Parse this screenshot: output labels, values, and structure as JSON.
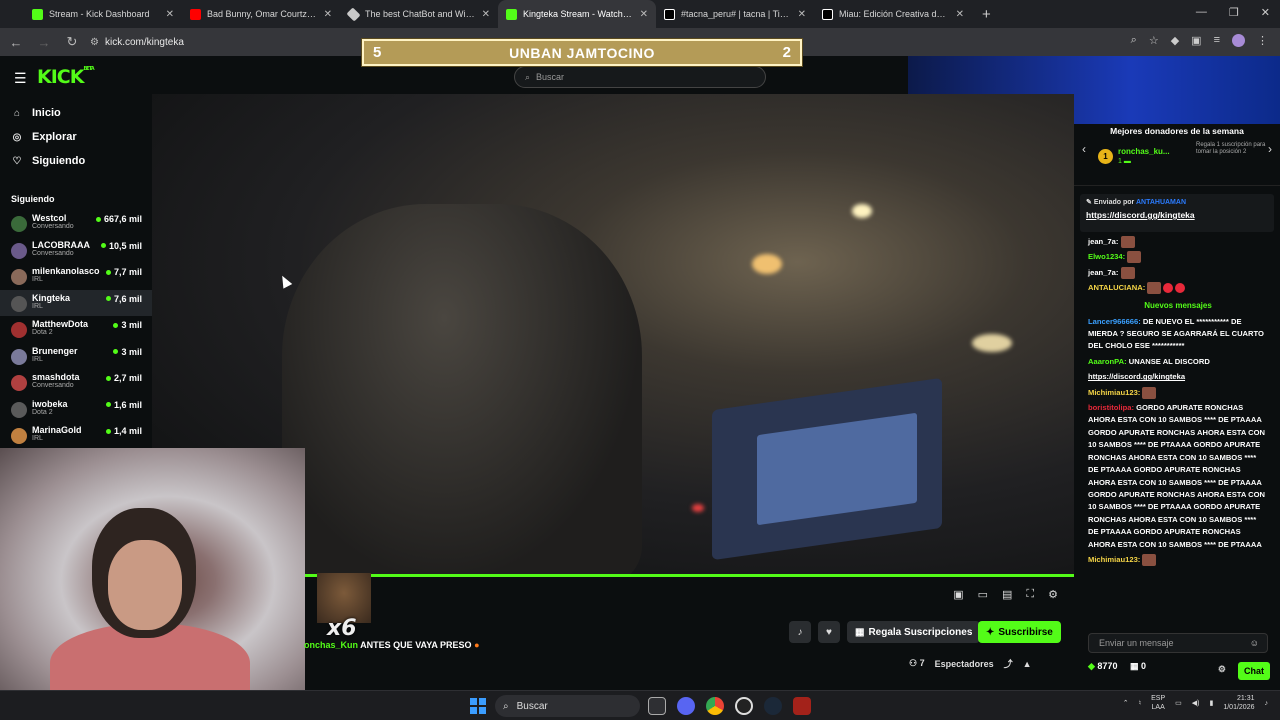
{
  "browser": {
    "tabs": [
      {
        "title": "Stream - Kick Dashboard",
        "color": "#53fc18",
        "active": false
      },
      {
        "title": "Bad Bunny, Omar Courtz, Dei V",
        "color": "#ff0000",
        "active": false
      },
      {
        "title": "The best ChatBot and Widgets",
        "color": "#c9c9c9",
        "active": false
      },
      {
        "title": "Kingteka Stream - Watch Live o",
        "color": "#53fc18",
        "active": true
      },
      {
        "title": "#tacna_peru# | tacna | TikTok",
        "color": "#ffffff",
        "active": false
      },
      {
        "title": "Miau: Edición Creativa de Josen",
        "color": "#ffffff",
        "active": false
      }
    ],
    "url": "kick.com/kingteka"
  },
  "banner": {
    "left": "5",
    "text": "UNBAN JAMTOCINO",
    "right": "2"
  },
  "header": {
    "search_placeholder": "Buscar"
  },
  "sidebar": {
    "nav": [
      {
        "label": "Inicio",
        "icon": "home-icon"
      },
      {
        "label": "Explorar",
        "icon": "compass-icon"
      },
      {
        "label": "Siguiendo",
        "icon": "heart-icon"
      }
    ],
    "following_title": "Siguiendo",
    "following": [
      {
        "name": "Westcol",
        "category": "Conversando",
        "viewers": "667,6 mil",
        "color": "#3a6a3a"
      },
      {
        "name": "LACOBRAAA",
        "category": "Conversando",
        "viewers": "10,5 mil",
        "color": "#6a5a8a"
      },
      {
        "name": "milenkanolasco",
        "category": "IRL",
        "viewers": "7,7 mil",
        "color": "#8a6a5a"
      },
      {
        "name": "Kingteka",
        "category": "IRL",
        "viewers": "7,6 mil",
        "color": "#555555"
      },
      {
        "name": "MatthewDota",
        "category": "Dota 2",
        "viewers": "3 mil",
        "color": "#a03030"
      },
      {
        "name": "Brunenger",
        "category": "IRL",
        "viewers": "3 mil",
        "color": "#7a7a9a"
      },
      {
        "name": "smashdota",
        "category": "Conversando",
        "viewers": "2,7 mil",
        "color": "#b04040"
      },
      {
        "name": "iwobeka",
        "category": "Dota 2",
        "viewers": "1,6 mil",
        "color": "#5a5a5a"
      },
      {
        "name": "MarinaGold",
        "category": "IRL",
        "viewers": "1,4 mil",
        "color": "#c08040"
      }
    ]
  },
  "alert": {
    "user": "onchas_Kun",
    "message": " ANTES QUE VAYA PRESO",
    "multiplier": "x6"
  },
  "channel": {
    "gift_label": "Regala Suscripciones",
    "subscribe_label": "Suscribirse",
    "viewers_label": "Espectadores",
    "viewers_count": "7"
  },
  "chat": {
    "donors_title": "Mejores donadores de la semana",
    "donor_rank": "1",
    "donor_name": "ronchas_ku...",
    "donor_amount": "1",
    "donor_hint": "Regala 1 suscripción para tomar la posición 2",
    "pinned_prefix": "Enviado por",
    "pinned_user": "ANTAHUAMAN",
    "pinned_link": "https://discord.gg/kingteka",
    "messages_top": [
      {
        "user": "jean_7a:",
        "color": "#ffffff",
        "text": ""
      },
      {
        "user": "Elwo1234:",
        "color": "#53fc18",
        "text": ""
      },
      {
        "user": "jean_7a:",
        "color": "#ffffff",
        "text": ""
      },
      {
        "user": "ANTALUCIANA:",
        "color": "#f5d547",
        "text": ""
      }
    ],
    "new_messages_label": "Nuevos mensajes",
    "messages": [
      {
        "user": "Lancer966666:",
        "color": "#3aa0ff",
        "text": " DE NUEVO EL *********** DE MIERDA ? SEGURO SE AGARRARÁ EL CUARTO DEL CHOLO ESE ***********"
      },
      {
        "user": "AaaronPA:",
        "color": "#53fc18",
        "text": " UNANSE AL DISCORD"
      },
      {
        "user": "",
        "color": "#ffffff",
        "text": "https://discord.gg/kingteka"
      },
      {
        "user": "Michimiau123:",
        "color": "#f5d547",
        "text": ""
      },
      {
        "user": "boristitolipa:",
        "color": "#e8293a",
        "text": " GORDO APURATE RONCHAS AHORA ESTA CON 10 SAMBOS **** DE PTAAAA GORDO APURATE RONCHAS AHORA ESTA CON 10 SAMBOS **** DE PTAAAA GORDO APURATE RONCHAS AHORA ESTA CON 10 SAMBOS **** DE PTAAAA GORDO APURATE RONCHAS AHORA ESTA CON 10 SAMBOS **** DE PTAAAA GORDO APURATE RONCHAS AHORA ESTA CON 10 SAMBOS **** DE PTAAAA GORDO APURATE RONCHAS AHORA ESTA CON 10 SAMBOS **** DE PTAAAA GORDO APURATE RONCHAS AHORA ESTA CON 10 SAMBOS **** DE PTAAAA"
      },
      {
        "user": "Michimiau123:",
        "color": "#f5d547",
        "text": ""
      }
    ],
    "input_placeholder": "Enviar un mensaje",
    "points": "8770",
    "subs_count": "0",
    "chat_button": "Chat"
  },
  "taskbar": {
    "search": "Buscar",
    "lang_top": "ESP",
    "lang_bottom": "LAA",
    "time": "21:31",
    "date": "1/01/2026"
  },
  "colors": {
    "accent": "#53fc18",
    "background": "#0b0e0f",
    "banner": "#b49b57"
  }
}
